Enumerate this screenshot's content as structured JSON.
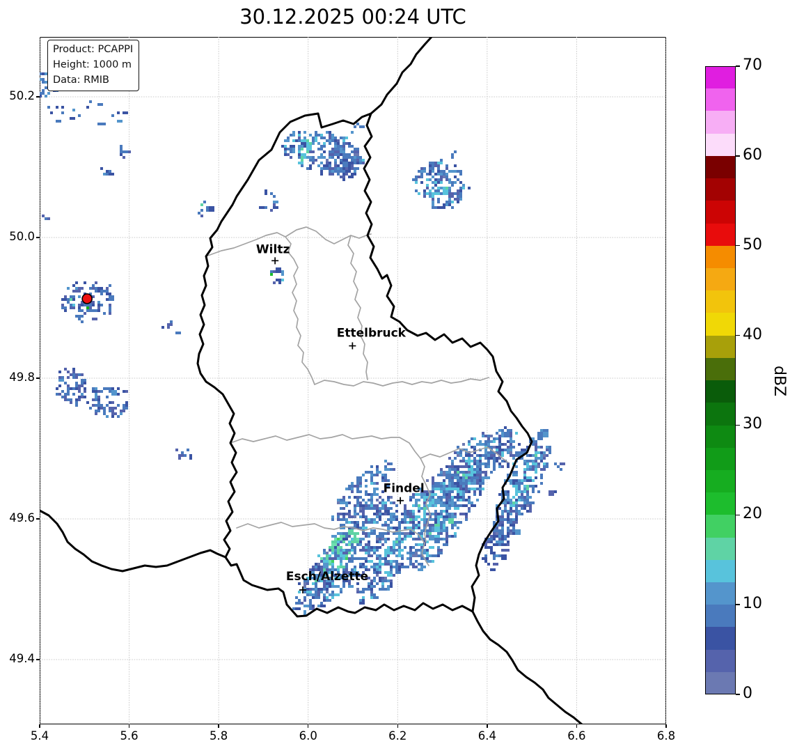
{
  "title": "30.12.2025 00:24 UTC",
  "info_box": {
    "product_line": "Product: PCAPPI",
    "height_line": "Height: 1000 m",
    "data_line": "Data: RMIB"
  },
  "colorbar": {
    "label": "dBZ",
    "vmin": 0,
    "vmax": 70,
    "step": 2.5,
    "tick_levels": [
      0,
      10,
      20,
      30,
      40,
      50,
      60,
      70
    ],
    "colors": [
      "#6b79b2",
      "#5563ac",
      "#3a53a3",
      "#4a7abd",
      "#5495cc",
      "#58c3dc",
      "#5fd3a5",
      "#41d063",
      "#1dbd2d",
      "#16ad20",
      "#119c18",
      "#0e8a12",
      "#0c750e",
      "#0a5c0a",
      "#4a6e0a",
      "#a8a00a",
      "#f0d806",
      "#f2c40c",
      "#f5a912",
      "#f58c00",
      "#e80c0c",
      "#cc0404",
      "#a30202",
      "#7a0000",
      "#fcdcfa",
      "#f7aef5",
      "#f063ee",
      "#e01ee0"
    ]
  },
  "chart_data": {
    "type": "heatmap",
    "title": "30.12.2025 00:24 UTC",
    "subtitle": "Radar reflectivity PCAPPI at 1000 m over Luxembourg (RMIB data)",
    "colorbar_label": "dBZ",
    "axes": {
      "xlim": [
        5.4,
        6.8
      ],
      "ylim": [
        49.308,
        50.285
      ],
      "grid": "dotted",
      "x_ticks": [
        {
          "v": 5.4,
          "label": "5.4"
        },
        {
          "v": 5.6,
          "label": "5.6"
        },
        {
          "v": 5.8,
          "label": "5.8"
        },
        {
          "v": 6.0,
          "label": "6.0"
        },
        {
          "v": 6.2,
          "label": "6.2"
        },
        {
          "v": 6.4,
          "label": "6.4"
        },
        {
          "v": 6.6,
          "label": "6.6"
        },
        {
          "v": 6.8,
          "label": "6.8"
        }
      ],
      "y_ticks": [
        {
          "v": 49.4,
          "label": "49.4"
        },
        {
          "v": 49.6,
          "label": "49.6"
        },
        {
          "v": 49.8,
          "label": "49.8"
        },
        {
          "v": 50.0,
          "label": "50.0"
        },
        {
          "v": 50.2,
          "label": "50.2"
        }
      ]
    },
    "cities": [
      {
        "name": "Wiltz",
        "lon": 5.926,
        "lat": 49.967,
        "ldx": -3,
        "ldy": -11
      },
      {
        "name": "Ettelbruck",
        "lon": 6.099,
        "lat": 49.846,
        "ldx": 27,
        "ldy": -13
      },
      {
        "name": "Findel",
        "lon": 6.206,
        "lat": 49.626,
        "ldx": 5,
        "ldy": -12
      },
      {
        "name": "Esch/Alzette",
        "lon": 5.988,
        "lat": 49.499,
        "ldx": 35,
        "ldy": -14
      }
    ],
    "radar_site": {
      "lon": 5.506,
      "lat": 49.913,
      "color": "#ee1111"
    },
    "palettes": {
      "blue_mix": [
        [
          "#4a7abd",
          5
        ],
        [
          "#5495cc",
          3
        ],
        [
          "#3a53a3",
          2
        ],
        [
          "#5563ac",
          2
        ],
        [
          "#58c3dc",
          0.8
        ],
        [
          "#6b79b2",
          0.4
        ]
      ],
      "blue_dark": [
        [
          "#3a53a3",
          4
        ],
        [
          "#4a7abd",
          3
        ],
        [
          "#5563ac",
          3
        ],
        [
          "#5495cc",
          1
        ]
      ],
      "speck": [
        [
          "#4a7abd",
          4
        ],
        [
          "#3a53a3",
          3
        ],
        [
          "#5563ac",
          3
        ],
        [
          "#5495cc",
          1
        ]
      ],
      "cyan_core": [
        [
          "#58c3dc",
          5
        ],
        [
          "#5495cc",
          1.5
        ],
        [
          "#5fd3a5",
          1
        ]
      ],
      "seafoam_core": [
        [
          "#5fd3a5",
          4
        ],
        [
          "#6fe0b0",
          2
        ],
        [
          "#58c3dc",
          2
        ],
        [
          "#41d063",
          1
        ]
      ],
      "edge_dense": [
        [
          "#4a7abd",
          4
        ],
        [
          "#3a53a3",
          3
        ],
        [
          "#5495cc",
          2
        ],
        [
          "#58c3dc",
          1
        ]
      ]
    },
    "echo_blobs": [
      {
        "name": "nw-edge-blob",
        "lon": 5.414,
        "lat": 50.224,
        "dlon": 0.02,
        "dlat": 0.02,
        "w": 0.02,
        "n": 50,
        "palette": "edge_dense"
      },
      {
        "name": "nw-speckles",
        "lon": 5.5,
        "lat": 50.178,
        "dlon": 0.095,
        "dlat": 0.004,
        "w": 0.022,
        "n": 26,
        "palette": "speck"
      },
      {
        "name": "speck-clervaux",
        "lon": 5.588,
        "lat": 50.125,
        "dlon": 0.018,
        "dlat": 0.006,
        "w": 0.012,
        "n": 12,
        "palette": "speck"
      },
      {
        "name": "speck-nw2",
        "lon": 5.545,
        "lat": 50.093,
        "dlon": 0.014,
        "dlat": 0.004,
        "w": 0.01,
        "n": 7,
        "palette": "speck"
      },
      {
        "name": "speck-bastogne",
        "lon": 5.762,
        "lat": 50.044,
        "dlon": 0.015,
        "dlat": 0.008,
        "w": 0.01,
        "n": 10,
        "palette": "speck"
      },
      {
        "name": "speck-north-wiltz",
        "lon": 5.906,
        "lat": 50.053,
        "dlon": 0.016,
        "dlat": -0.01,
        "w": 0.014,
        "n": 14,
        "palette": "speck"
      },
      {
        "name": "north-band",
        "lon": 6.03,
        "lat": 50.124,
        "dlon": 0.092,
        "dlat": -0.013,
        "w": 0.028,
        "n": 235,
        "palette": "blue_mix"
      },
      {
        "name": "north-band-core",
        "lon": 5.993,
        "lat": 50.128,
        "dlon": 0.024,
        "dlat": -0.004,
        "w": 0.014,
        "n": 26,
        "palette": "cyan_core"
      },
      {
        "name": "north-band-south",
        "lon": 6.072,
        "lat": 50.103,
        "dlon": 0.035,
        "dlat": -0.008,
        "w": 0.02,
        "n": 70,
        "palette": "blue_dark"
      },
      {
        "name": "ne-blob",
        "lon": 6.294,
        "lat": 50.076,
        "dlon": 0.058,
        "dlat": -0.012,
        "w": 0.034,
        "n": 165,
        "palette": "blue_mix"
      },
      {
        "name": "ne-blob-core",
        "lon": 6.282,
        "lat": 50.07,
        "dlon": 0.016,
        "dlat": 0.008,
        "w": 0.012,
        "n": 20,
        "palette": "cyan_core"
      },
      {
        "name": "wiltz-specks",
        "lon": 5.925,
        "lat": 49.946,
        "dlon": 0.014,
        "dlat": -0.006,
        "w": 0.01,
        "n": 8,
        "palette": "speck"
      },
      {
        "name": "radar-clutter",
        "lon": 5.506,
        "lat": 49.912,
        "dlon": 0.062,
        "dlat": 0.002,
        "w": 0.03,
        "n": 118,
        "palette": "speck"
      },
      {
        "name": "radar-clutter-core",
        "lon": 5.506,
        "lat": 49.91,
        "dlon": 0.014,
        "dlat": 0.002,
        "w": 0.009,
        "n": 14,
        "palette": "blue_dark"
      },
      {
        "name": "speck-mid-west",
        "lon": 5.689,
        "lat": 49.874,
        "dlon": 0.012,
        "dlat": 0.008,
        "w": 0.012,
        "n": 9,
        "palette": "speck"
      },
      {
        "name": "west-cluster-1",
        "lon": 5.467,
        "lat": 49.791,
        "dlon": 0.034,
        "dlat": 0.01,
        "w": 0.026,
        "n": 82,
        "palette": "speck"
      },
      {
        "name": "west-cluster-2",
        "lon": 5.548,
        "lat": 49.77,
        "dlon": 0.04,
        "dlat": -0.012,
        "w": 0.026,
        "n": 92,
        "palette": "speck"
      },
      {
        "name": "speck-left-edge",
        "lon": 5.406,
        "lat": 50.028,
        "dlon": 0.008,
        "dlat": 0.004,
        "w": 0.008,
        "n": 5,
        "palette": "speck"
      },
      {
        "name": "speck-sw",
        "lon": 5.724,
        "lat": 49.696,
        "dlon": 0.013,
        "dlat": 0.01,
        "w": 0.013,
        "n": 12,
        "palette": "speck"
      },
      {
        "name": "south-band-1",
        "lon": 6.089,
        "lat": 49.555,
        "dlon": 0.097,
        "dlat": 0.079,
        "w": 0.033,
        "n": 470,
        "palette": "blue_mix"
      },
      {
        "name": "south-band-1-core",
        "lon": 6.058,
        "lat": 49.549,
        "dlon": 0.047,
        "dlat": 0.036,
        "w": 0.017,
        "n": 95,
        "palette": "seafoam_core"
      },
      {
        "name": "south-band-2",
        "lon": 6.218,
        "lat": 49.58,
        "dlon": 0.109,
        "dlat": 0.096,
        "w": 0.028,
        "n": 500,
        "palette": "blue_mix"
      },
      {
        "name": "south-band-2-core",
        "lon": 6.226,
        "lat": 49.59,
        "dlon": 0.075,
        "dlat": 0.066,
        "w": 0.01,
        "n": 75,
        "palette": "cyan_core"
      },
      {
        "name": "south-band-3",
        "lon": 6.315,
        "lat": 49.612,
        "dlon": 0.086,
        "dlat": 0.085,
        "w": 0.025,
        "n": 380,
        "palette": "blue_mix"
      },
      {
        "name": "south-band-3-core",
        "lon": 6.315,
        "lat": 49.619,
        "dlon": 0.055,
        "dlat": 0.055,
        "w": 0.008,
        "n": 48,
        "palette": "cyan_core"
      },
      {
        "name": "findel-ne-blob",
        "lon": 6.357,
        "lat": 49.676,
        "dlon": 0.056,
        "dlat": 0.042,
        "w": 0.03,
        "n": 210,
        "palette": "blue_mix"
      },
      {
        "name": "findel-ne-core",
        "lon": 6.349,
        "lat": 49.672,
        "dlon": 0.02,
        "dlat": 0.016,
        "w": 0.009,
        "n": 22,
        "palette": "cyan_core"
      },
      {
        "name": "findel-west-arm",
        "lon": 6.12,
        "lat": 49.639,
        "dlon": 0.065,
        "dlat": 0.045,
        "w": 0.022,
        "n": 170,
        "palette": "blue_mix"
      },
      {
        "name": "sw-small-band",
        "lon": 6.014,
        "lat": 49.508,
        "dlon": 0.045,
        "dlat": 0.038,
        "w": 0.02,
        "n": 115,
        "palette": "blue_mix"
      },
      {
        "name": "east-band",
        "lon": 6.472,
        "lat": 49.647,
        "dlon": 0.054,
        "dlat": 0.082,
        "w": 0.025,
        "n": 330,
        "palette": "blue_mix"
      },
      {
        "name": "east-band-core",
        "lon": 6.478,
        "lat": 49.654,
        "dlon": 0.033,
        "dlat": 0.05,
        "w": 0.008,
        "n": 42,
        "palette": "cyan_core"
      },
      {
        "name": "east-north-blob",
        "lon": 6.434,
        "lat": 49.704,
        "dlon": 0.038,
        "dlat": 0.018,
        "w": 0.025,
        "n": 95,
        "palette": "blue_mix"
      },
      {
        "name": "east-south-tail",
        "lon": 6.425,
        "lat": 49.575,
        "dlon": 0.028,
        "dlat": 0.045,
        "w": 0.018,
        "n": 90,
        "palette": "blue_dark"
      },
      {
        "name": "speck-east-1",
        "lon": 6.556,
        "lat": 49.676,
        "dlon": 0.008,
        "dlat": 0.006,
        "w": 0.007,
        "n": 4,
        "palette": "speck"
      },
      {
        "name": "speck-east-2",
        "lon": 6.545,
        "lat": 49.64,
        "dlon": 0.007,
        "dlat": 0.005,
        "w": 0.006,
        "n": 3,
        "palette": "speck"
      },
      {
        "name": "speck-top",
        "lon": 6.1,
        "lat": 50.155,
        "dlon": 0.012,
        "dlat": 0.004,
        "w": 0.008,
        "n": 5,
        "palette": "speck"
      },
      {
        "name": "speck-top-ne",
        "lon": 6.324,
        "lat": 50.12,
        "dlon": 0.005,
        "dlat": 0.003,
        "w": 0.005,
        "n": 2,
        "palette": "speck"
      }
    ],
    "echo_cells": [
      {
        "lon": 5.915,
        "lat": 49.948,
        "color": "#1dbd2d"
      },
      {
        "lon": 5.937,
        "lat": 49.943,
        "color": "#58c3dc"
      },
      {
        "lon": 5.503,
        "lat": 49.902,
        "color": "#16ad20"
      },
      {
        "lon": 5.468,
        "lat": 49.913,
        "color": "#5fd3a5"
      },
      {
        "lon": 5.472,
        "lat": 49.906,
        "color": "#58c3dc"
      },
      {
        "lon": 5.762,
        "lat": 50.047,
        "color": "#5fd3a5"
      }
    ]
  }
}
